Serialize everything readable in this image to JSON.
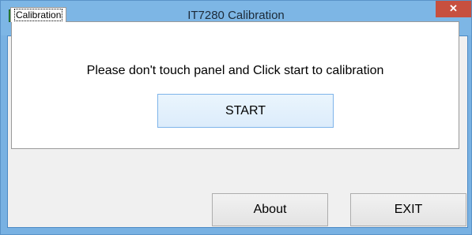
{
  "window": {
    "title": "IT7280 Calibration",
    "close_symbol": "✕",
    "app_icon": "app-icon"
  },
  "tabs": [
    {
      "label": "Calibration",
      "selected": true
    }
  ],
  "panel": {
    "instruction": "Please don't touch panel and Click start to calibration",
    "start_label": "START"
  },
  "footer": {
    "about_label": "About",
    "exit_label": "EXIT"
  },
  "colors": {
    "titlebar": "#7db6e5",
    "close_button": "#c7503f",
    "start_button": "#dcecfb",
    "start_border": "#7eb4ea"
  }
}
